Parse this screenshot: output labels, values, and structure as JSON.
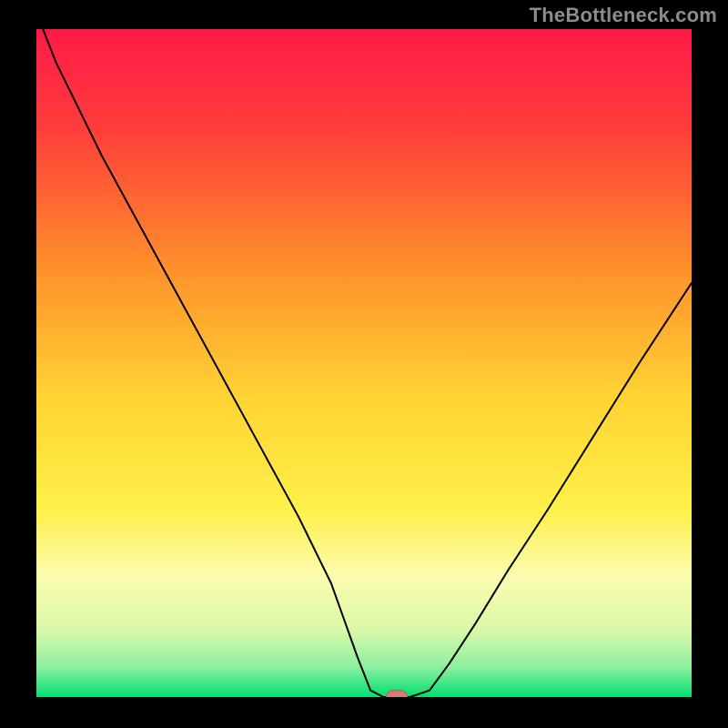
{
  "attribution": "TheBottleneck.com",
  "chart_data": {
    "type": "line",
    "title": "",
    "xlabel": "",
    "ylabel": "",
    "xlim": [
      0,
      100
    ],
    "ylim": [
      0,
      100
    ],
    "legend": false,
    "grid": false,
    "background_gradient_stops": [
      {
        "pos": 0.0,
        "color": "#ff1a48"
      },
      {
        "pos": 0.15,
        "color": "#ff3d3b"
      },
      {
        "pos": 0.35,
        "color": "#ff8d2c"
      },
      {
        "pos": 0.55,
        "color": "#ffd333"
      },
      {
        "pos": 0.72,
        "color": "#fff04a"
      },
      {
        "pos": 0.82,
        "color": "#fcfcb0"
      },
      {
        "pos": 0.9,
        "color": "#d9f9a8"
      },
      {
        "pos": 0.955,
        "color": "#8cf0a0"
      },
      {
        "pos": 1.0,
        "color": "#00e070"
      }
    ],
    "series": [
      {
        "name": "bottleneck-curve",
        "color": "#000000",
        "stroke_width": 2,
        "x": [
          1,
          3,
          6,
          10,
          15,
          20,
          25,
          30,
          35,
          40,
          45,
          49,
          51,
          53,
          55,
          57,
          60,
          63,
          67,
          72,
          78,
          85,
          92,
          100
        ],
        "y": [
          100,
          95,
          89,
          81,
          72,
          63,
          54,
          45,
          36,
          27,
          17,
          6,
          1,
          0,
          0,
          0,
          1,
          5,
          11,
          19,
          28,
          39,
          50,
          62
        ]
      }
    ],
    "marker": {
      "shape": "stadium",
      "name": "optimal-point",
      "x": 55,
      "y": 0,
      "width_pct": 3.2,
      "height_pct": 2.0,
      "fill": "#d77c6f",
      "stroke": "#b85c50"
    }
  }
}
